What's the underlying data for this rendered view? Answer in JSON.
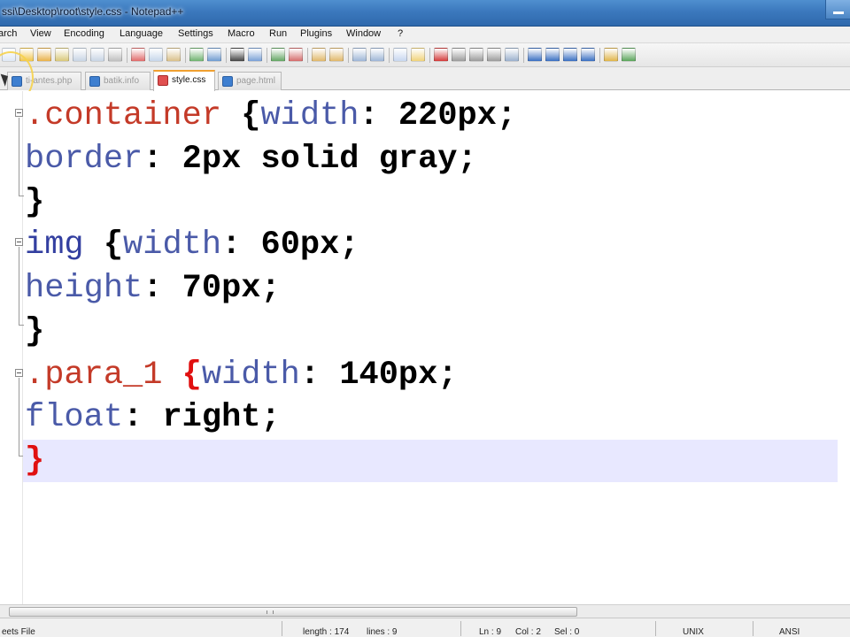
{
  "window": {
    "title": "ssi\\Desktop\\root\\style.css - Notepad++"
  },
  "menu": [
    "arch",
    "View",
    "Encoding",
    "Language",
    "Settings",
    "Macro",
    "Run",
    "Plugins",
    "Window",
    "?"
  ],
  "toolbar": {
    "icons": [
      {
        "name": "new-file-icon",
        "color": "#dfe8f5"
      },
      {
        "name": "open-file-icon",
        "color": "#f2c64a"
      },
      {
        "name": "save-icon",
        "color": "#e9b24a"
      },
      {
        "name": "save-all-icon",
        "color": "#d9c87a"
      },
      {
        "name": "close-icon",
        "color": "#c8d4e4"
      },
      {
        "name": "close-all-icon",
        "color": "#c8d4e4"
      },
      {
        "name": "print-icon",
        "color": "#bfbfbf"
      },
      {
        "name": "cut-icon",
        "color": "#e06a6a"
      },
      {
        "name": "copy-icon",
        "color": "#c6d5ea"
      },
      {
        "name": "paste-icon",
        "color": "#d9c08a"
      },
      {
        "name": "undo-icon",
        "color": "#6fb36f"
      },
      {
        "name": "redo-icon",
        "color": "#6f9bd0"
      },
      {
        "name": "find-icon",
        "color": "#444444"
      },
      {
        "name": "replace-icon",
        "color": "#7aa0d6"
      },
      {
        "name": "zoom-in-icon",
        "color": "#63a663"
      },
      {
        "name": "zoom-out-icon",
        "color": "#d46b6b"
      },
      {
        "name": "sync-v-icon",
        "color": "#e0b86a"
      },
      {
        "name": "sync-h-icon",
        "color": "#e0b86a"
      },
      {
        "name": "word-wrap-icon",
        "color": "#9db6d6"
      },
      {
        "name": "show-all-icon",
        "color": "#9db6d6"
      },
      {
        "name": "indent-guide-icon",
        "color": "#c7d6ef"
      },
      {
        "name": "user-lang-icon",
        "color": "#f0d27a"
      },
      {
        "name": "record-macro-icon",
        "color": "#d33b3b"
      },
      {
        "name": "stop-macro-icon",
        "color": "#9a9a9a"
      },
      {
        "name": "play-macro-icon",
        "color": "#9a9a9a"
      },
      {
        "name": "play-multiple-icon",
        "color": "#9a9a9a"
      },
      {
        "name": "save-macro-icon",
        "color": "#9ab0cc"
      },
      {
        "name": "fold-all-icon",
        "color": "#3a6fc2"
      },
      {
        "name": "prev-bookmark-icon",
        "color": "#3a6fc2"
      },
      {
        "name": "next-bookmark-icon",
        "color": "#3a6fc2"
      },
      {
        "name": "toggle-bookmark-icon",
        "color": "#3a6fc2"
      },
      {
        "name": "monitoring-icon",
        "color": "#e0b54a"
      },
      {
        "name": "spell-check-icon",
        "color": "#5aa55a"
      }
    ]
  },
  "tabs": [
    {
      "label": "ti-antes.php",
      "active": false
    },
    {
      "label": "batik.info",
      "active": false
    },
    {
      "label": "style.css",
      "active": true
    },
    {
      "label": "page.html",
      "active": false
    }
  ],
  "code": {
    "line1": {
      "selector": ".container",
      "open": " {",
      "prop": "width",
      "colon": ":",
      "value": " 220px",
      "semi": ";"
    },
    "line2": {
      "prop": "border",
      "colon": ":",
      "value": " 2px solid gray",
      "semi": ";"
    },
    "line3": {
      "close": "}"
    },
    "line4": {
      "selector": "img",
      "open": " {",
      "prop": "width",
      "colon": ":",
      "value": " 60px",
      "semi": ";"
    },
    "line5": {
      "prop": "height",
      "colon": ":",
      "value": " 70px",
      "semi": ";"
    },
    "line6": {
      "close": "}"
    },
    "line7": {
      "selector": ".para_1",
      "open": " {",
      "prop": "width",
      "colon": ":",
      "value": " 140px",
      "semi": ";"
    },
    "line8": {
      "prop": "float",
      "colon": ":",
      "value": " right",
      "semi": ";"
    },
    "line9": {
      "close": "}"
    }
  },
  "status": {
    "file_type": "eets File",
    "length": "length : 174",
    "lines": "lines : 9",
    "ln": "Ln : 9",
    "col": "Col : 2",
    "sel": "Sel : 0",
    "eol": "UNIX",
    "encoding": "ANSI"
  }
}
